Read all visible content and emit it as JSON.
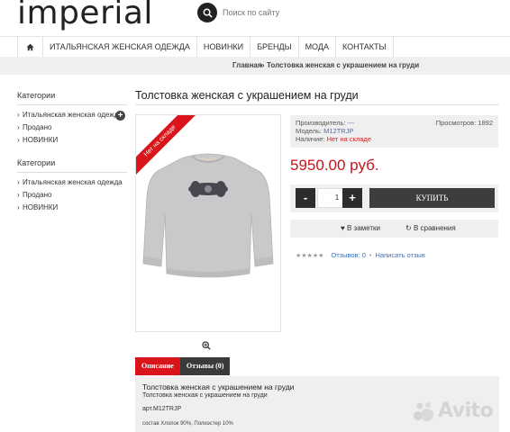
{
  "header": {
    "logo": "imperial",
    "search_placeholder": "Поиск по сайту"
  },
  "nav": {
    "items": [
      "ИТАЛЬЯНСКАЯ ЖЕНСКАЯ ОДЕЖДА",
      "НОВИНКИ",
      "БРЕНДЫ",
      "МОДА",
      "КОНТАКТЫ"
    ]
  },
  "breadcrumb": {
    "home": "Главная",
    "separator": "»",
    "current": "Толстовка женская с украшением на груди"
  },
  "sidebar": {
    "sections": [
      {
        "heading": "Категории",
        "items": [
          "Итальянская женская одежда",
          "Продано",
          "НОВИНКИ"
        ]
      },
      {
        "heading": "Категории",
        "items": [
          "Итальянская женская одежда",
          "Продано",
          "НОВИНКИ"
        ]
      }
    ]
  },
  "product": {
    "title": "Толстовка женская с украшением на груди",
    "ribbon": "Нет на складе",
    "manufacturer_label": "Производитель:",
    "manufacturer_value": "---",
    "model_label": "Модель:",
    "model_value": "M12TRJP",
    "availability_label": "Наличие:",
    "availability_value": "Нет на складе",
    "views_label": "Просмотров:",
    "views_value": "1892",
    "price": "5950.00 руб.",
    "qty_minus": "-",
    "qty_value": "1",
    "qty_plus": "+",
    "buy_label": "КУПИТЬ",
    "wishlist_label": "В заметки",
    "compare_label": "В сравнения",
    "reviews_label": "Отзывов: 0",
    "write_review_label": "Написать отзыв",
    "rating": 0,
    "rating_max": 5
  },
  "tabs": {
    "description": "Описание",
    "reviews": "Отзывы (0)"
  },
  "description": {
    "line1": "Толстовка женская с украшением на груди",
    "line2": "Толстовка женская  с украшением на груди",
    "sku": "арт.M12TRJP",
    "composition_label": "состав",
    "composition_value": "Хлопок 90%, Полиэстер 10%"
  },
  "watermark": {
    "text": "Avito"
  },
  "colors": {
    "accent_red": "#d9151b",
    "price_red": "#c8141a",
    "dark_button": "#2c2c2c",
    "panel_gray": "#efefef",
    "link_blue": "#3a6fb0"
  }
}
